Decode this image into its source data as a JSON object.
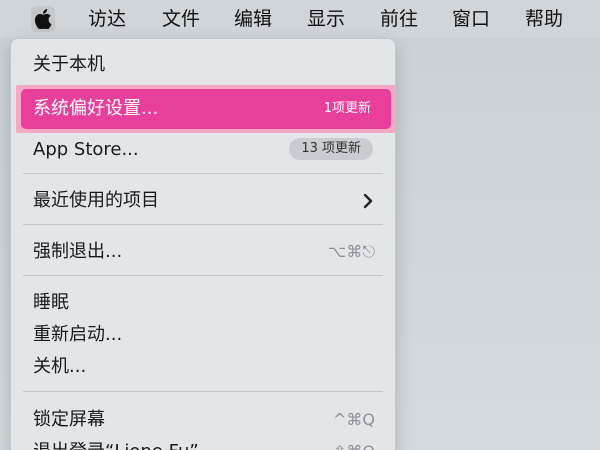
{
  "menubar": {
    "apple_icon": "apple-logo-icon",
    "items": [
      "访达",
      "文件",
      "编辑",
      "显示",
      "前往",
      "窗口",
      "帮助"
    ]
  },
  "dropdown": {
    "about": "关于本机",
    "system_prefs": {
      "label": "系统偏好设置...",
      "badge": "1项更新"
    },
    "app_store": {
      "label": "App Store...",
      "badge": "13 项更新"
    },
    "recent_items": {
      "label": "最近使用的项目",
      "icon": "chevron-right-icon"
    },
    "force_quit": {
      "label": "强制退出...",
      "shortcut": "⌥⌘⎋"
    },
    "sleep": "睡眠",
    "restart": "重新启动...",
    "shutdown": "关机...",
    "lock_screen": {
      "label": "锁定屏幕",
      "shortcut": "^⌘Q"
    },
    "log_out": {
      "label": "退出登录“Lione Fu”...",
      "shortcut": "⇧⌘Q"
    }
  },
  "colors": {
    "selection": "#e8409a",
    "selection_frame": "#f5a9c4",
    "menu_background": "#e3e6e9"
  }
}
